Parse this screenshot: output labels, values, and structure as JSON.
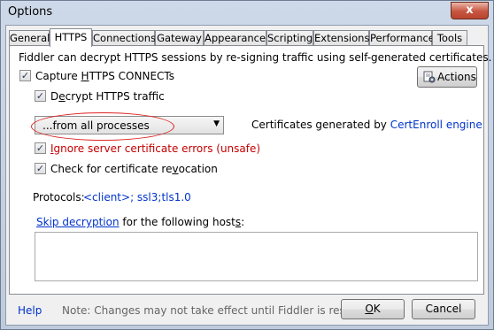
{
  "window": {
    "title": "Options",
    "close_label": "x"
  },
  "tabs": [
    {
      "label": "General",
      "active": false
    },
    {
      "label": "HTTPS",
      "active": true
    },
    {
      "label": "Connections",
      "active": false
    },
    {
      "label": "Gateway",
      "active": false
    },
    {
      "label": "Appearance",
      "active": false
    },
    {
      "label": "Scripting",
      "active": false
    },
    {
      "label": "Extensions",
      "active": false
    },
    {
      "label": "Performance",
      "active": false
    },
    {
      "label": "Tools",
      "active": false
    }
  ],
  "https": {
    "description": "Fiddler can decrypt HTTPS sessions by re-signing traffic using self-generated certificates.",
    "capture_connects": {
      "pre": "Capture ",
      "key": "H",
      "post": "TTPS CONNECTs",
      "checked": true
    },
    "actions_button": "Actions",
    "decrypt": {
      "pre": "D",
      "key": "e",
      "post": "crypt HTTPS traffic",
      "checked": true
    },
    "process_filter": {
      "value": "...from all processes",
      "arrow": "▼"
    },
    "cert_text": "Certificates generated by ",
    "cert_engine": "CertEnroll engine",
    "ignore_errors": {
      "key": "I",
      "post": "gnore server certificate errors (unsafe)",
      "checked": true
    },
    "revocation": {
      "pre": "Check for certificate re",
      "key": "v",
      "post": "ocation",
      "checked": true
    },
    "protocols_label": "Protocols: ",
    "protocols_value": "<client>; ssl3;tls1.0",
    "skip_link": "Skip decryption",
    "skip_text_pre": " for the following host",
    "skip_key": "s",
    "skip_text_post": ":",
    "hosts_value": ""
  },
  "footer": {
    "help": "Help",
    "note": "Note: Changes may not take effect until Fiddler is restarted.",
    "ok_key": "O",
    "ok_post": "K",
    "cancel": "Cancel"
  },
  "check_glyph": "✓"
}
